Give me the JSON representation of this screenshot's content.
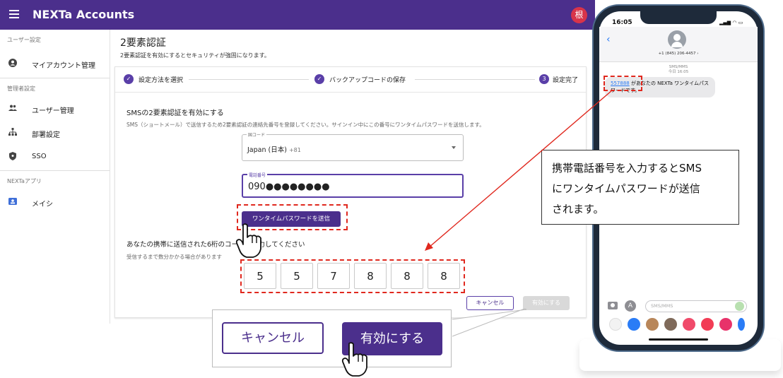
{
  "app": {
    "title": "NEXTa Accounts",
    "avatar_text": "根"
  },
  "sidebar": {
    "sections": [
      {
        "title": "ユーザー設定",
        "items": [
          {
            "label": "マイアカウント管理",
            "icon": "account-circle-icon"
          }
        ]
      },
      {
        "title": "管理者設定",
        "items": [
          {
            "label": "ユーザー管理",
            "icon": "people-icon"
          },
          {
            "label": "部署設定",
            "icon": "org-chart-icon"
          },
          {
            "label": "SSO",
            "icon": "shield-icon"
          }
        ]
      },
      {
        "title": "NEXTaアプリ",
        "items": [
          {
            "label": "メイシ",
            "icon": "contact-card-icon"
          }
        ]
      }
    ]
  },
  "page": {
    "title": "2要素認証",
    "subtitle": "2要素認証を有効にするとセキュリティが強固になります。"
  },
  "stepper": {
    "steps": [
      {
        "label": "設定方法を選択",
        "state": "done"
      },
      {
        "label": "バックアップコードの保存",
        "state": "done"
      },
      {
        "label": "設定完了",
        "number": "3",
        "state": "current"
      }
    ]
  },
  "sms": {
    "title": "SMSの2要素認証を有効にする",
    "description": "SMS（ショートメール）で送信するため2要素認証の連絡先番号を登録してください。サインイン中にこの番号にワンタイムパスワードを送信します。",
    "country_label": "国コード",
    "country_value": "Japan (日本)",
    "country_code": "+81",
    "phone_label": "電話番号",
    "phone_value": "090●●●●●●●●",
    "send_button": "ワンタイムパスワードを送信"
  },
  "code": {
    "title": "あなたの携帯に送信された6桁のコードを入力してください",
    "hint": "受信するまで数分かかる場合があります",
    "digits": [
      "5",
      "5",
      "7",
      "8",
      "8",
      "8"
    ]
  },
  "actions": {
    "cancel": "キャンセル",
    "enable": "有効にする"
  },
  "zoom": {
    "cancel": "キャンセル",
    "enable": "有効にする"
  },
  "annotation": {
    "lines": [
      "携帯電話番号を入力するとSMS",
      "にワンタイムパスワードが送信",
      "されます。"
    ]
  },
  "phone_mock": {
    "time": "16:05",
    "contact_number": "+1 (845) 206-4457",
    "channel": "SMS/MMS",
    "timestamp": "今日 16:05",
    "message_code": "557888",
    "message_text": " があなたの NEXTa ワンタイムパスワードです。",
    "input_placeholder": "SMS/MMS"
  },
  "colors": {
    "brand": "#4b2f8c",
    "accent": "#5a3fa8",
    "highlight": "#e0281e",
    "avatar": "#d8344a"
  }
}
